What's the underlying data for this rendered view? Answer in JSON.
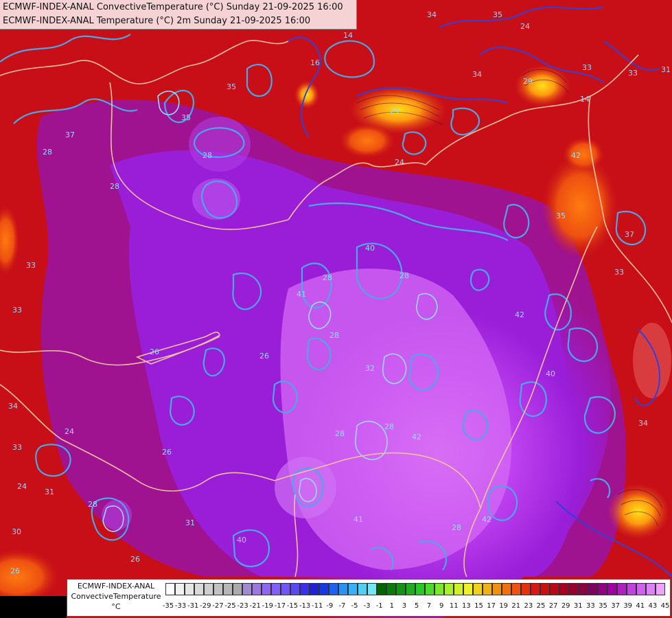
{
  "header": {
    "line1": "ECMWF-INDEX-ANAL ConvectiveTemperature (°C) Sunday 21-09-2025 16:00",
    "line2": "ECMWF-INDEX-ANAL Temperature (°C) 2m Sunday 21-09-2025 16:00"
  },
  "legend": {
    "title_line1": "ECMWF-INDEX-ANAL",
    "title_line2": "ConvectiveTemperature",
    "unit": "°C",
    "tick_labels": [
      "-35",
      "-33",
      "-31",
      "-29",
      "-27",
      "-25",
      "-23",
      "-21",
      "-19",
      "-17",
      "-15",
      "-13",
      "-11",
      "-9",
      "-7",
      "-5",
      "-3",
      "-1",
      "1",
      "3",
      "5",
      "7",
      "9",
      "11",
      "13",
      "15",
      "17",
      "19",
      "21",
      "23",
      "25",
      "27",
      "29",
      "31",
      "33",
      "35",
      "37",
      "39",
      "41",
      "43",
      "45"
    ],
    "colors": [
      "#ffffff",
      "#f2f2f2",
      "#e6e6e6",
      "#dadada",
      "#cecece",
      "#c2c2c2",
      "#b6b6b6",
      "#aaaaaa",
      "#a08ad0",
      "#9a78e0",
      "#9066f0",
      "#8060f8",
      "#7058f8",
      "#5a48f0",
      "#3a30e8",
      "#2020d8",
      "#1838e0",
      "#2060f0",
      "#2890f8",
      "#38b0f8",
      "#50d0f8",
      "#70e8f8",
      "#006400",
      "#0a7a0a",
      "#149414",
      "#1eae1e",
      "#28c828",
      "#48dc28",
      "#78e828",
      "#a8f028",
      "#d0f028",
      "#f0f028",
      "#f0d020",
      "#f0b018",
      "#f09010",
      "#f07010",
      "#f05010",
      "#e83010",
      "#d81818",
      "#c81010",
      "#b80818",
      "#a80020",
      "#980030",
      "#8a0040",
      "#800060",
      "#900080",
      "#a000a0",
      "#b020c0",
      "#c040e0",
      "#d060f0",
      "#e080f8",
      "#f0a0ff"
    ]
  },
  "map": {
    "contour_labels": [
      "34",
      "14",
      "16",
      "35",
      "24",
      "35",
      "24",
      "33",
      "14",
      "24",
      "33",
      "31",
      "37",
      "28",
      "35",
      "28",
      "35",
      "42",
      "33",
      "40",
      "28",
      "41",
      "28",
      "26",
      "32",
      "28",
      "42",
      "26",
      "28",
      "42",
      "41",
      "40",
      "42",
      "28",
      "28",
      "34",
      "26",
      "33",
      "31",
      "24",
      "30",
      "26",
      "37",
      "28",
      "26",
      "24",
      "29",
      "34",
      "40",
      "31",
      "34",
      "33",
      "28",
      "33"
    ]
  }
}
